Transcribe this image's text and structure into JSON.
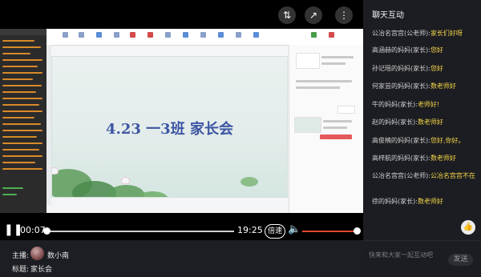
{
  "video": {
    "slide_title": "4.23 一3班 家长会",
    "current_time": "00:07",
    "duration": "19:25",
    "speed_label": "倍速",
    "progress": 0.006,
    "volume": 1.0
  },
  "info": {
    "host_label": "主播:",
    "host_name": "数小南",
    "title_label": "标题:",
    "title_value": "家长会"
  },
  "chat": {
    "title": "聊天互动",
    "messages": [
      {
        "name": "公冶名宫宫(公老师):",
        "text": "家长们好呀"
      },
      {
        "name": "高涵赫的妈妈(家长):",
        "text": "您好"
      },
      {
        "name": "孙记瑶的妈妈(家长):",
        "text": "您好"
      },
      {
        "name": "何家芸的妈妈(家长):",
        "text": "数老师好"
      },
      {
        "name": "牛的妈妈(家长):",
        "text": "老师好!"
      },
      {
        "name": "赵的妈妈(家长):",
        "text": "数老师好"
      },
      {
        "name": "高俊楠的妈妈(家长):",
        "text": "您好,你好。"
      },
      {
        "name": "高梓航的妈妈(家长):",
        "text": "数老师好"
      },
      {
        "name": "公冶名宫宫(公老师):",
        "text": "公冶名宫宫不在"
      },
      {
        "name": "徐的妈妈(家长):",
        "text": "数老师好"
      }
    ],
    "input_placeholder": "快来和大家一起互动吧",
    "send_label": "发送"
  },
  "colors": {
    "accent_orange": "#e04a2f",
    "chat_highlight": "#f6d74a",
    "slide_title": "#3d55a3"
  },
  "icons": {
    "top_bar": [
      "camera-switch-icon",
      "share-icon",
      "more-icon"
    ],
    "controls": [
      "pause-icon",
      "volume-icon"
    ],
    "like": "thumbs-up-icon"
  }
}
